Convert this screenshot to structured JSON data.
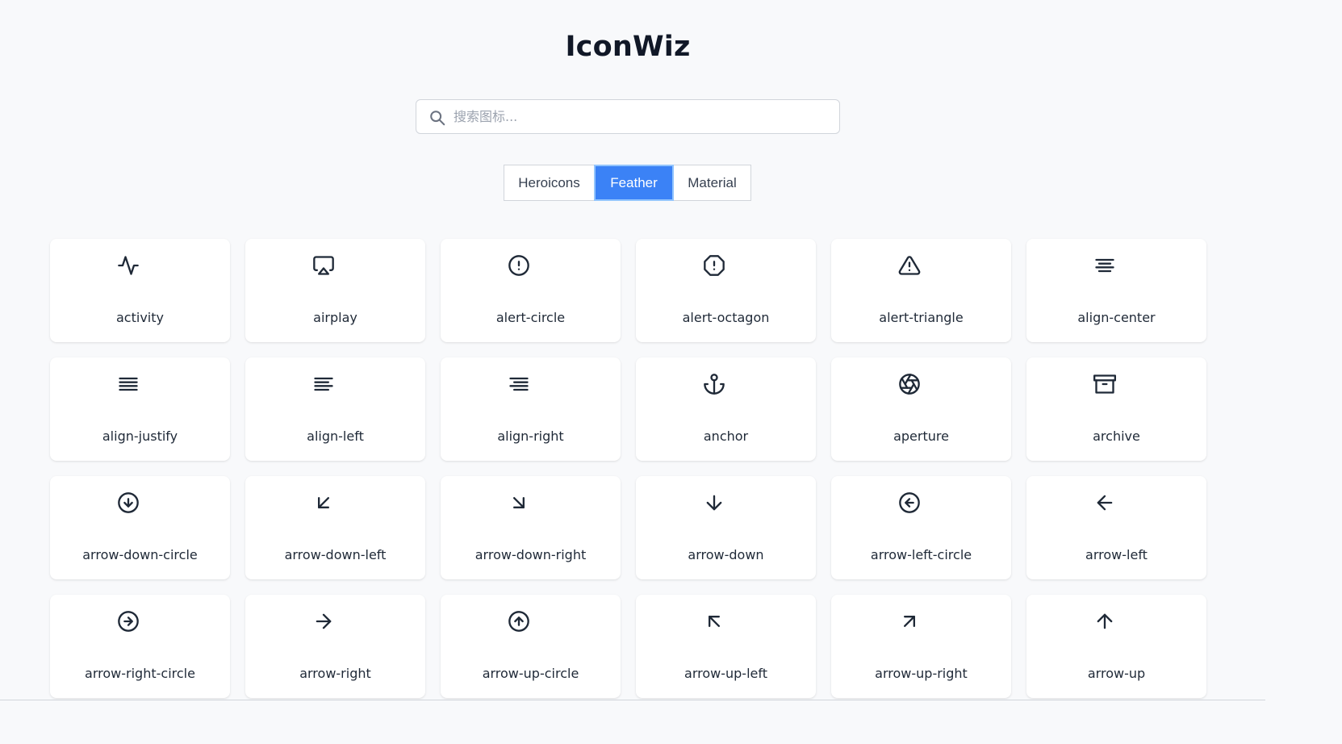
{
  "app": {
    "title": "IconWiz"
  },
  "search": {
    "placeholder": "搜索图标...",
    "value": ""
  },
  "tabs": [
    {
      "label": "Heroicons",
      "active": false
    },
    {
      "label": "Feather",
      "active": true
    },
    {
      "label": "Material",
      "active": false
    }
  ],
  "icons": [
    {
      "name": "activity",
      "icon": "activity-icon"
    },
    {
      "name": "airplay",
      "icon": "airplay-icon"
    },
    {
      "name": "alert-circle",
      "icon": "alert-circle-icon"
    },
    {
      "name": "alert-octagon",
      "icon": "alert-octagon-icon"
    },
    {
      "name": "alert-triangle",
      "icon": "alert-triangle-icon"
    },
    {
      "name": "align-center",
      "icon": "align-center-icon"
    },
    {
      "name": "align-justify",
      "icon": "align-justify-icon"
    },
    {
      "name": "align-left",
      "icon": "align-left-icon"
    },
    {
      "name": "align-right",
      "icon": "align-right-icon"
    },
    {
      "name": "anchor",
      "icon": "anchor-icon"
    },
    {
      "name": "aperture",
      "icon": "aperture-icon"
    },
    {
      "name": "archive",
      "icon": "archive-icon"
    },
    {
      "name": "arrow-down-circle",
      "icon": "arrow-down-circle-icon"
    },
    {
      "name": "arrow-down-left",
      "icon": "arrow-down-left-icon"
    },
    {
      "name": "arrow-down-right",
      "icon": "arrow-down-right-icon"
    },
    {
      "name": "arrow-down",
      "icon": "arrow-down-icon"
    },
    {
      "name": "arrow-left-circle",
      "icon": "arrow-left-circle-icon"
    },
    {
      "name": "arrow-left",
      "icon": "arrow-left-icon"
    },
    {
      "name": "arrow-right-circle",
      "icon": "arrow-right-circle-icon"
    },
    {
      "name": "arrow-right",
      "icon": "arrow-right-icon"
    },
    {
      "name": "arrow-up-circle",
      "icon": "arrow-up-circle-icon"
    },
    {
      "name": "arrow-up-left",
      "icon": "arrow-up-left-icon"
    },
    {
      "name": "arrow-up-right",
      "icon": "arrow-up-right-icon"
    },
    {
      "name": "arrow-up",
      "icon": "arrow-up-icon"
    }
  ],
  "colors": {
    "accent": "#3b82f6",
    "background": "#f8f9fb",
    "card": "#ffffff",
    "text": "#1f2937"
  }
}
